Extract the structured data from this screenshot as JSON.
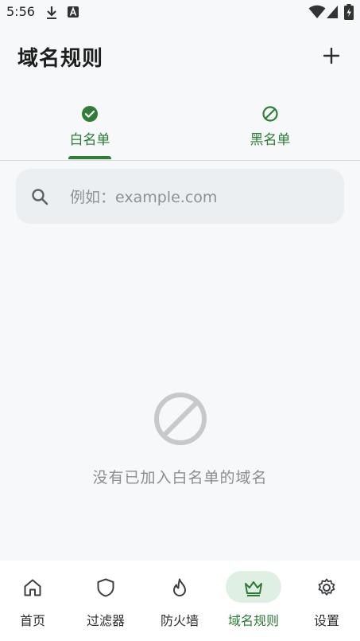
{
  "status_bar": {
    "time": "5:56"
  },
  "app_bar": {
    "title": "域名规则",
    "add_icon": "plus-icon"
  },
  "tabs": [
    {
      "label": "白名单",
      "icon": "check-circle-icon",
      "selected": true
    },
    {
      "label": "黑名单",
      "icon": "block-icon",
      "selected": false
    }
  ],
  "search": {
    "placeholder": "例如：example.com",
    "value": ""
  },
  "empty_state": {
    "icon": "block-icon",
    "text": "没有已加入白名单的域名"
  },
  "bottom_nav": [
    {
      "label": "首页",
      "icon": "home-icon",
      "active": false
    },
    {
      "label": "过滤器",
      "icon": "shield-icon",
      "active": false
    },
    {
      "label": "防火墙",
      "icon": "flame-icon",
      "active": false
    },
    {
      "label": "域名规则",
      "icon": "crown-icon",
      "active": true
    },
    {
      "label": "设置",
      "icon": "gear-icon",
      "active": false
    }
  ],
  "colors": {
    "accent": "#2f7d37",
    "background": "#f6f8fa",
    "active_pill": "#dff0e2"
  }
}
